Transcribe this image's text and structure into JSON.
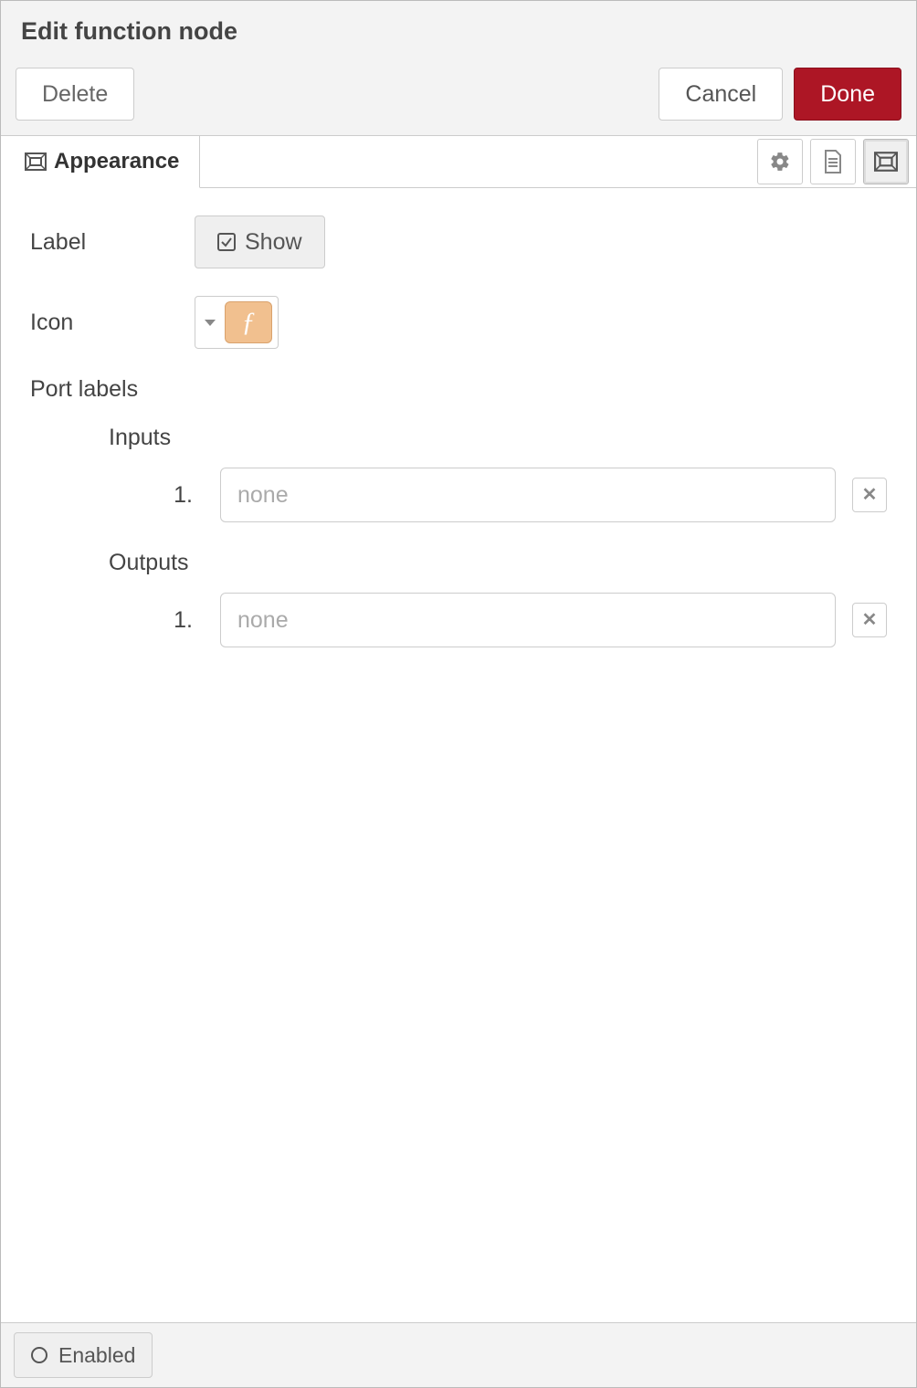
{
  "header": {
    "title": "Edit function node"
  },
  "buttons": {
    "delete": "Delete",
    "cancel": "Cancel",
    "done": "Done"
  },
  "tabs": {
    "appearance": "Appearance"
  },
  "tab_icons": {
    "settings": "gear-icon",
    "description": "document-icon",
    "appearance": "appearance-icon"
  },
  "form": {
    "label_label": "Label",
    "show_button": "Show",
    "icon_label": "Icon",
    "icon_glyph": "ƒ",
    "port_labels_heading": "Port labels",
    "inputs_heading": "Inputs",
    "outputs_heading": "Outputs",
    "inputs": [
      {
        "index": "1.",
        "value": "",
        "placeholder": "none"
      }
    ],
    "outputs": [
      {
        "index": "1.",
        "value": "",
        "placeholder": "none"
      }
    ]
  },
  "footer": {
    "enabled": "Enabled"
  }
}
